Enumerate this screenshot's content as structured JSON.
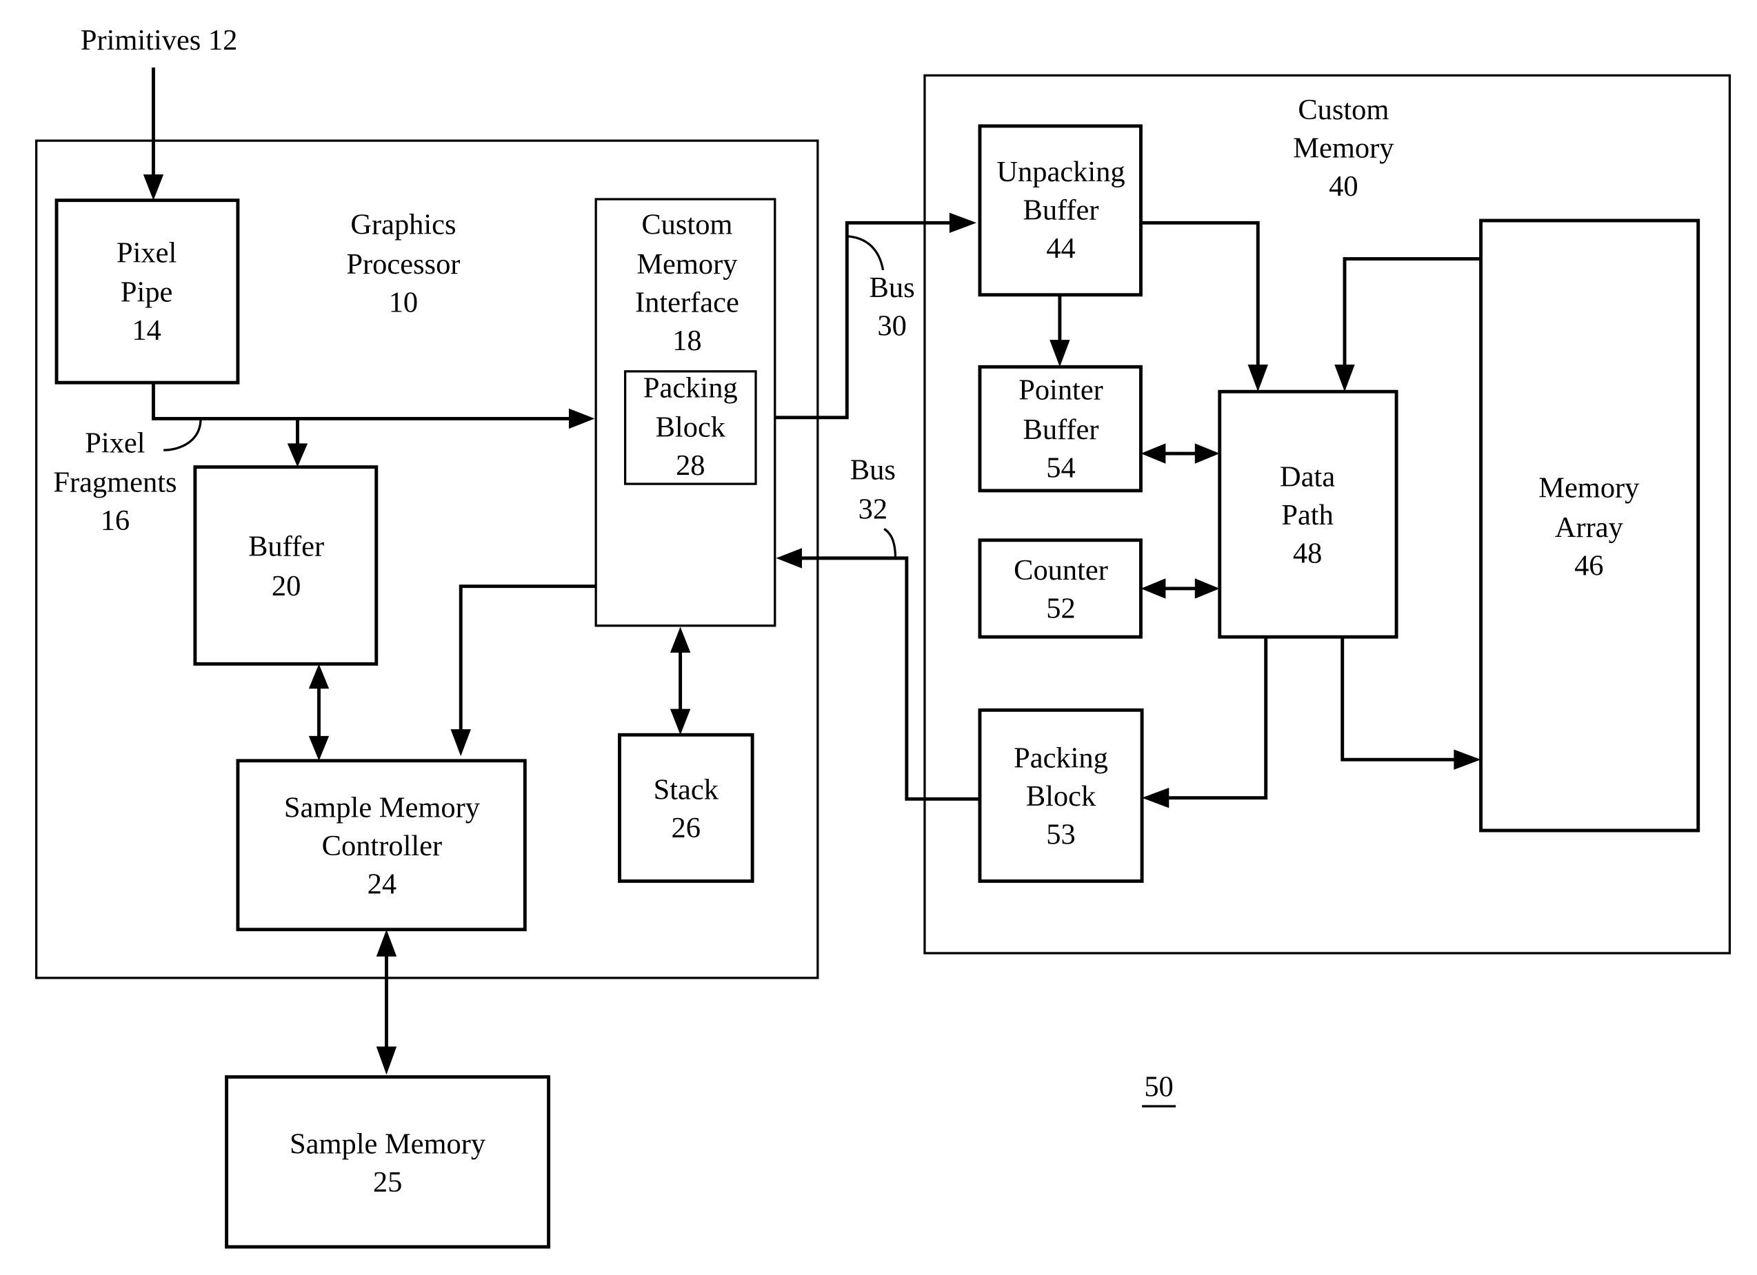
{
  "figure": {
    "reference_numeral": "50",
    "input_label": "Primitives 12"
  },
  "graphics_processor": {
    "title": [
      "Graphics",
      "Processor",
      "10"
    ],
    "blocks": {
      "pixel_pipe": [
        "Pixel",
        "Pipe",
        "14"
      ],
      "pixel_fragments": [
        "Pixel",
        "Fragments",
        "16"
      ],
      "buffer": [
        "Buffer",
        "20"
      ],
      "custom_memory_interface": [
        "Custom",
        "Memory",
        "Interface",
        "18"
      ],
      "packing_block": [
        "Packing",
        "Block",
        "28"
      ],
      "sample_memory_controller": [
        "Sample Memory",
        "Controller",
        "24"
      ],
      "stack": [
        "Stack",
        "26"
      ]
    }
  },
  "sample_memory": [
    "Sample Memory",
    "25"
  ],
  "buses": {
    "bus30": [
      "Bus",
      "30"
    ],
    "bus32": [
      "Bus",
      "32"
    ]
  },
  "custom_memory": {
    "title": [
      "Custom",
      "Memory",
      "40"
    ],
    "blocks": {
      "unpacking_buffer": [
        "Unpacking",
        "Buffer",
        "44"
      ],
      "pointer_buffer": [
        "Pointer",
        "Buffer",
        "54"
      ],
      "counter": [
        "Counter",
        "52"
      ],
      "data_path": [
        "Data",
        "Path",
        "48"
      ],
      "memory_array": [
        "Memory",
        "Array",
        "46"
      ],
      "packing_block": [
        "Packing",
        "Block",
        "53"
      ]
    }
  }
}
